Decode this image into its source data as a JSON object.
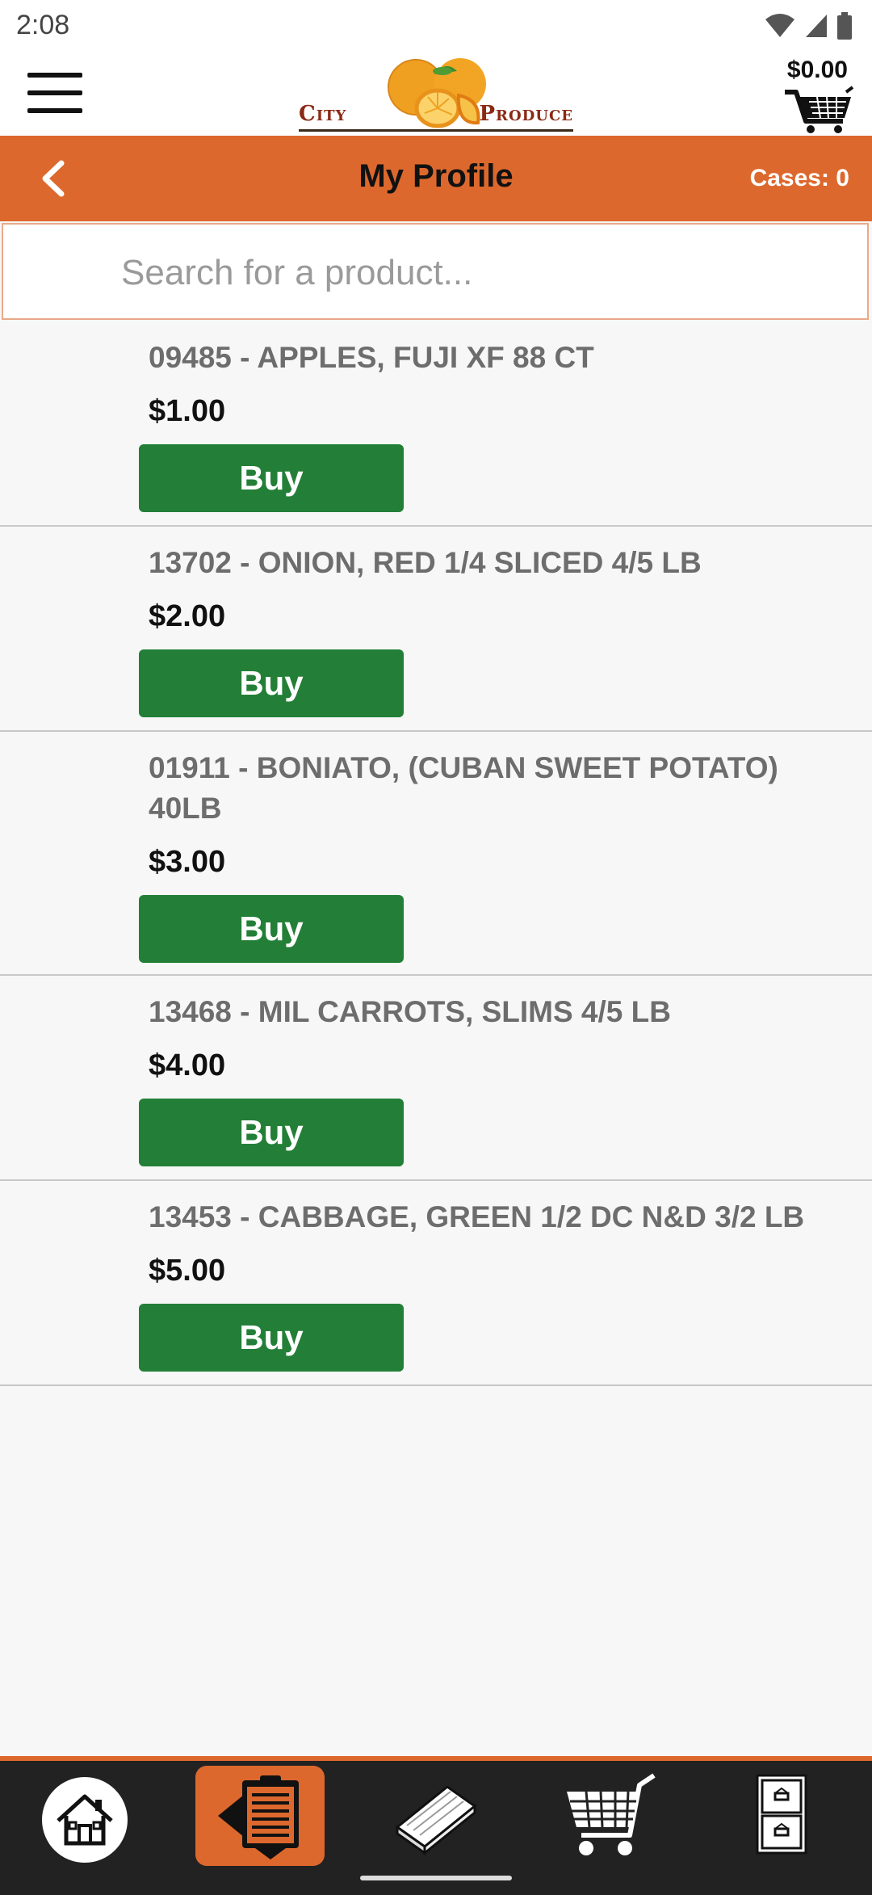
{
  "status": {
    "time": "2:08"
  },
  "header": {
    "logo_left": "City",
    "logo_right": "Produce",
    "cart_total": "$0.00"
  },
  "titlebar": {
    "title": "My Profile",
    "cases": "Cases: 0"
  },
  "search": {
    "placeholder": "Search for a product..."
  },
  "products": [
    {
      "name": "09485 - APPLES, FUJI XF 88 CT",
      "price": "$1.00",
      "button": "Buy"
    },
    {
      "name": "13702 - ONION, RED 1/4 SLICED 4/5 LB",
      "price": "$2.00",
      "button": "Buy"
    },
    {
      "name": "01911 - BONIATO, (CUBAN SWEET POTATO) 40LB",
      "price": "$3.00",
      "button": "Buy"
    },
    {
      "name": "13468 - MIL CARROTS, SLIMS 4/5 LB",
      "price": "$4.00",
      "button": "Buy"
    },
    {
      "name": "13453 - CABBAGE, GREEN 1/2 DC N&D 3/2 LB",
      "price": "$5.00",
      "button": "Buy"
    }
  ],
  "bottom_nav": [
    {
      "icon": "home-icon",
      "active": false
    },
    {
      "icon": "clipboard-back-icon",
      "active": true
    },
    {
      "icon": "book-icon",
      "active": false
    },
    {
      "icon": "cart-icon",
      "active": false
    },
    {
      "icon": "cabinet-icon",
      "active": false
    }
  ],
  "colors": {
    "accent": "#dd682d",
    "buy_button": "#237f37",
    "nav_background": "#222222"
  }
}
